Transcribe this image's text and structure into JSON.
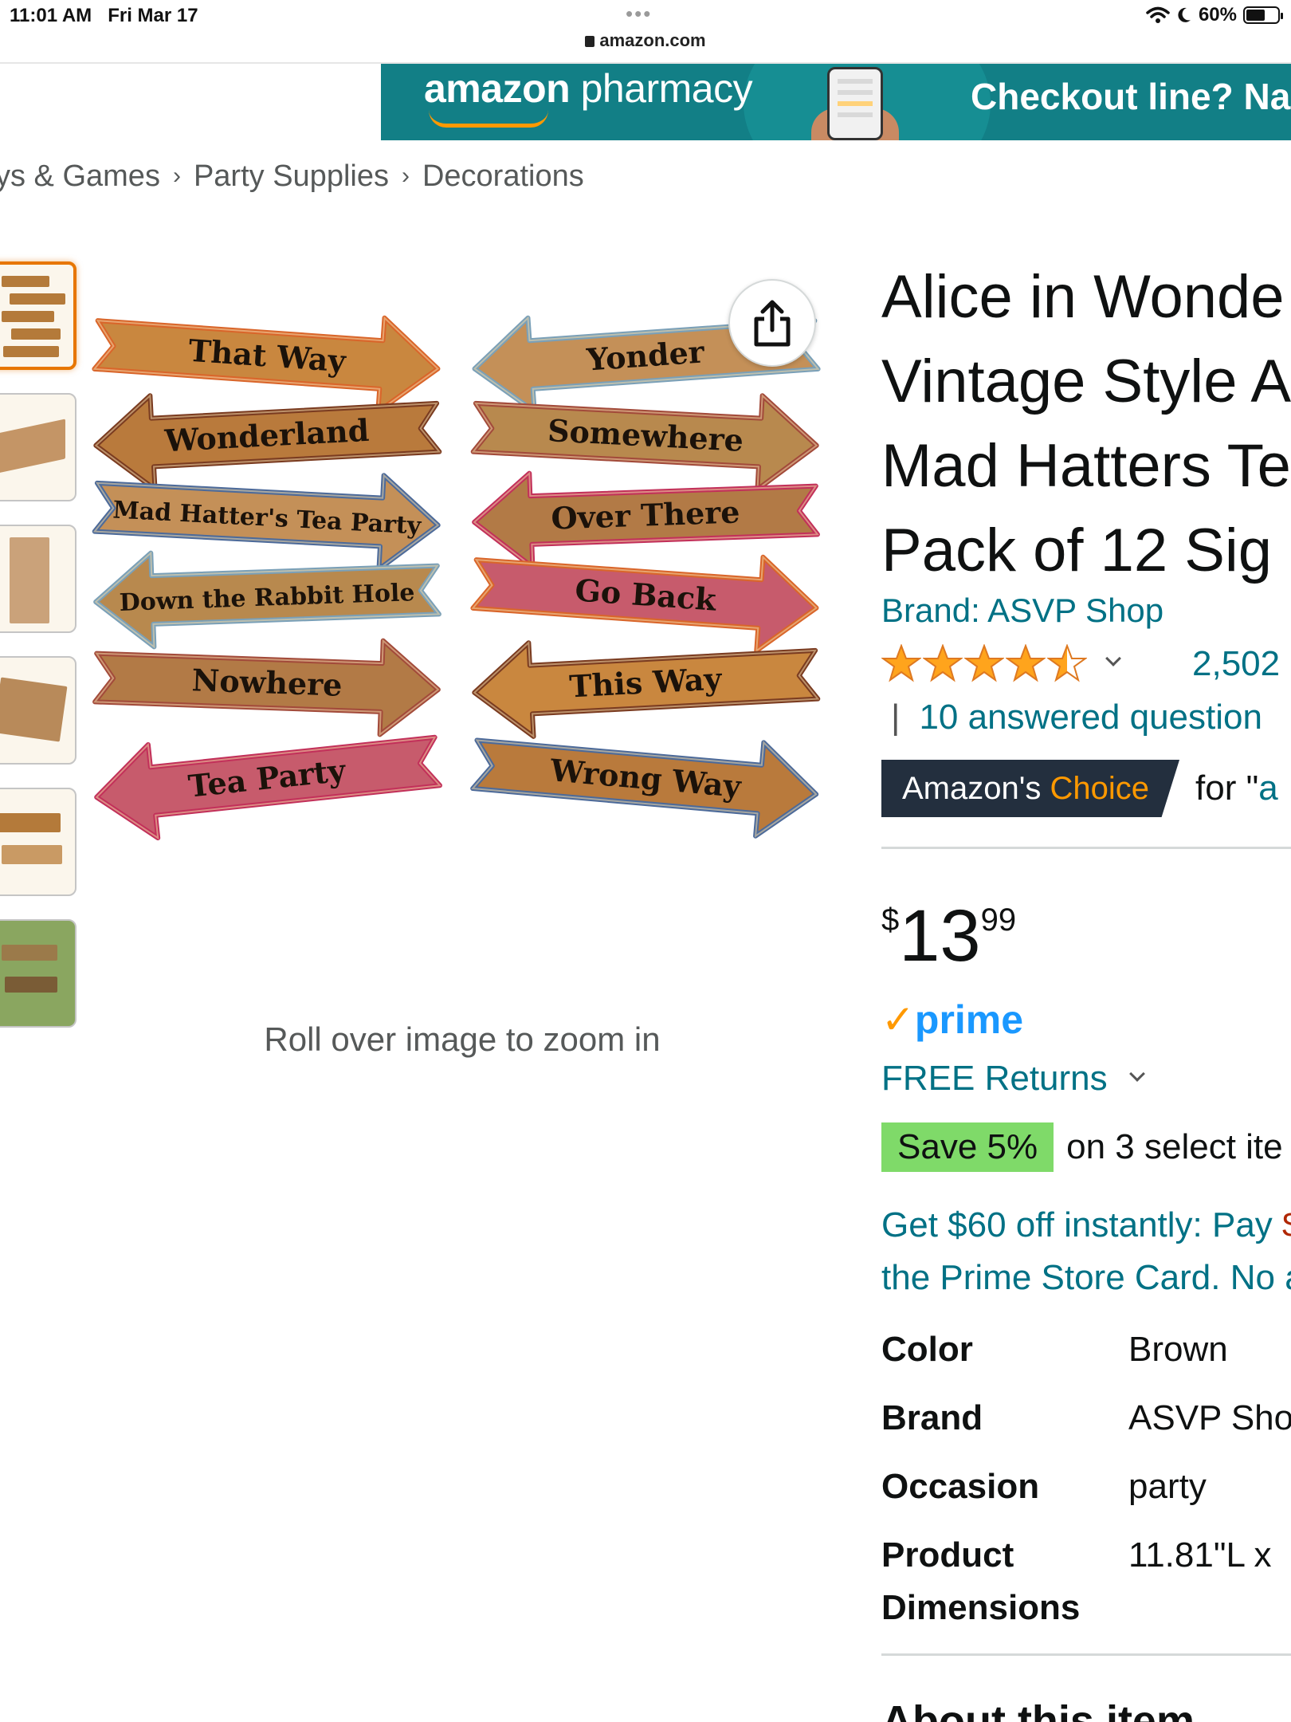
{
  "status_bar": {
    "time": "11:01 AM",
    "date": "Fri Mar 17",
    "battery": "60%",
    "battery_level": 0.6,
    "url": "amazon.com"
  },
  "banner": {
    "logo_word1": "amazon",
    "logo_word2": "pharmacy",
    "cta": "Checkout line? Na"
  },
  "breadcrumb": [
    "ys & Games",
    "Party Supplies",
    "Decorations"
  ],
  "gallery": {
    "thumbnail_count": 6,
    "selected_index": 0,
    "zoom_hint": "Roll over image to zoom in"
  },
  "sign_labels_left": [
    "That Way",
    "Wonderland",
    "Mad Hatter's Tea Party",
    "Down the Rabbit Hole",
    "Nowhere",
    "Tea Party"
  ],
  "sign_labels_right": [
    "Yonder",
    "Somewhere",
    "Over There",
    "Go Back",
    "This Way",
    "Wrong Way"
  ],
  "product": {
    "title_lines": [
      "Alice in Wonde",
      "Vintage Style A",
      "Mad Hatters Te",
      "Pack of 12 Sig"
    ],
    "brand": "Brand: ASVP Shop",
    "rating": 4.5,
    "ratings_count": "2,502",
    "answered": "10 answered question",
    "choice_badge_prefix": "Amazon's ",
    "choice_badge_word": "Choice",
    "choice_for": "for \"",
    "choice_query": "a",
    "price_symbol": "$",
    "price_whole": "13",
    "price_fraction": "99",
    "prime_label": "prime",
    "returns": "FREE Returns",
    "save_badge": "Save 5%",
    "save_text": "on 3 select ite",
    "promo_line1_a": "Get $60 off instantly: Pay ",
    "promo_line1_b": "$",
    "promo_line2": "the Prime Store Card. No a"
  },
  "specs": [
    {
      "key": "Color",
      "value": "Brown"
    },
    {
      "key": "Brand",
      "value": "ASVP Sho"
    },
    {
      "key": "Occasion",
      "value": "party"
    },
    {
      "key": "Product Dimensions",
      "value": "11.81\"L x"
    }
  ],
  "about_heading": "About this item",
  "colors": {
    "link": "#007185",
    "prime_blue": "#1a98ff",
    "accent_orange": "#ff9900",
    "badge_dark": "#232f3e",
    "save_green": "#7fda69",
    "banner_teal": "#127f86",
    "star": "#ffa41c"
  }
}
